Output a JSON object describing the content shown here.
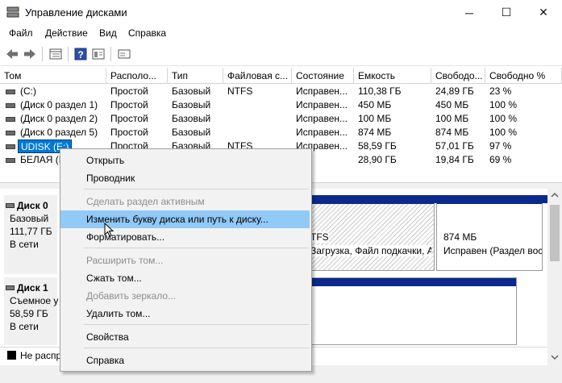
{
  "window": {
    "title": "Управление дисками",
    "controls": {
      "minimize": "─",
      "maximize": "☐",
      "close": "✕"
    }
  },
  "menu": [
    "Файл",
    "Действие",
    "Вид",
    "Справка"
  ],
  "toolbar": {
    "icons": [
      "back-icon",
      "forward-icon",
      "list-view-icon",
      "help-icon",
      "properties-icon",
      "disk-icon"
    ]
  },
  "columns": [
    "Том",
    "Располо...",
    "Тип",
    "Файловая с...",
    "Состояние",
    "Емкость",
    "Свободо...",
    "Свободно %"
  ],
  "volumes": [
    {
      "name": "(C:)",
      "layout": "Простой",
      "type": "Базовый",
      "fs": "NTFS",
      "status": "Исправен...",
      "capacity": "110,38 ГБ",
      "free": "24,89 ГБ",
      "free_pct": "23 %"
    },
    {
      "name": "(Диск 0 раздел 1)",
      "layout": "Простой",
      "type": "Базовый",
      "fs": "",
      "status": "Исправен...",
      "capacity": "450 МБ",
      "free": "450 МБ",
      "free_pct": "100 %"
    },
    {
      "name": "(Диск 0 раздел 2)",
      "layout": "Простой",
      "type": "Базовый",
      "fs": "",
      "status": "Исправен...",
      "capacity": "100 МБ",
      "free": "100 МБ",
      "free_pct": "100 %"
    },
    {
      "name": "(Диск 0 раздел 5)",
      "layout": "Простой",
      "type": "Базовый",
      "fs": "",
      "status": "Исправен...",
      "capacity": "874 МБ",
      "free": "874 МБ",
      "free_pct": "100 %"
    },
    {
      "name": "UDISK (E:)",
      "layout": "Простой",
      "type": "Базовый",
      "fs": "NTFS",
      "status": "Исправен...",
      "capacity": "58,59 ГБ",
      "free": "57,01 ГБ",
      "free_pct": "97 %"
    },
    {
      "name": "БЕЛАЯ (Н",
      "layout": "",
      "type": "",
      "fs": "",
      "status": "",
      "capacity": "28,90 ГБ",
      "free": "19,84 ГБ",
      "free_pct": "69 %"
    }
  ],
  "disks": [
    {
      "name": "Диск 0",
      "kind": "Базовый",
      "size": "111,77 ГБ",
      "state": "В сети",
      "partitions": [
        {
          "line1": "TFS",
          "line2": "Загрузка, Файл подкачки, А"
        },
        {
          "line1": "874 МБ",
          "line2": "Исправен (Раздел вос"
        }
      ]
    },
    {
      "name": "Диск 1",
      "kind": "Съемное у",
      "size": "58,59 ГБ",
      "state": "В сети"
    }
  ],
  "legend": {
    "label": "Не распр"
  },
  "context_menu": {
    "items": [
      {
        "label": "Открыть",
        "enabled": true
      },
      {
        "label": "Проводник",
        "enabled": true
      },
      {
        "label": "Сделать раздел активным",
        "enabled": false
      },
      {
        "label": "Изменить букву диска или путь к диску...",
        "enabled": true,
        "highlighted": true
      },
      {
        "label": "Форматировать...",
        "enabled": true
      },
      {
        "label": "Расширить том...",
        "enabled": false
      },
      {
        "label": "Сжать том...",
        "enabled": true
      },
      {
        "label": "Добавить зеркало...",
        "enabled": false
      },
      {
        "label": "Удалить том...",
        "enabled": true
      },
      {
        "label": "Свойства",
        "enabled": true
      },
      {
        "label": "Справка",
        "enabled": true
      }
    ]
  },
  "colors": {
    "accent": "#0078d7",
    "partition_header": "#0b2a8c",
    "menu_highlight": "#91c9f7"
  }
}
